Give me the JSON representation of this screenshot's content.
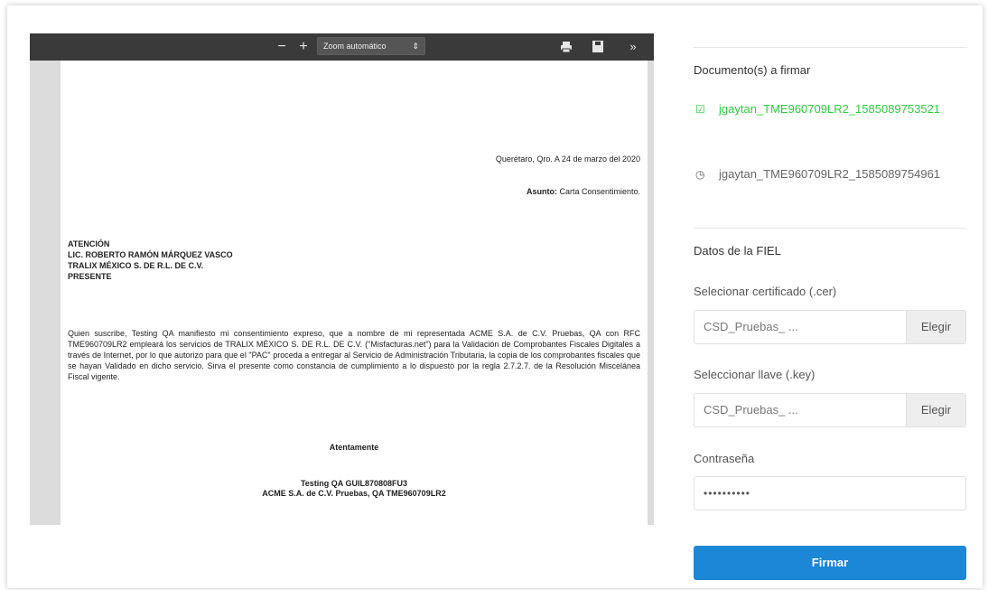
{
  "viewer": {
    "toolbar": {
      "zoom_out": "−",
      "zoom_in": "+",
      "zoom_label": "Zoom automático",
      "zoom_caret": "⇕",
      "print_icon": "print-icon",
      "save_icon": "save-icon",
      "more_icon": "double-chevron-right-icon"
    },
    "page": {
      "place_date": "Querétaro, Qro. A 24 de marzo del 2020",
      "subject_label": "Asunto:",
      "subject_value": " Carta Consentimiento.",
      "addressee": [
        "ATENCIÓN",
        "LIC. ROBERTO RAMÓN MÁRQUEZ VASCO",
        "TRALIX MÉXICO S. DE R.L. DE C.V.",
        "PRESENTE"
      ],
      "body": "Quien suscribe, Testing QA manifiesto mi consentimiento expreso, que a nombre de mi representada ACME S.A. de C.V. Pruebas, QA con RFC TME960709LR2 empleará los servicios de TRALIX MÉXICO S. DE R.L. DE C.V. (\"Misfacturas.net\") para la Validación de Comprobantes Fiscales Digitales a través de Internet, por lo que autorizo para que el \"PAC\" proceda a entregar al Servicio de Administración Tributaria, la copia de los comprobantes fiscales que se hayan Validado en dicho servicio. Sirva el presente como constancia de cumplimiento a lo dispuesto por la regla 2.7.2.7. de la Resolución Miscelánea Fiscal vigente.",
      "closing": "Atentamente",
      "signer_line1": "Testing QA GUIL870808FU3",
      "signer_line2": "ACME S.A. de C.V. Pruebas, QA TME960709LR2"
    }
  },
  "panel": {
    "documents_title": "Documento(s) a firmar",
    "documents": [
      {
        "name": "jgaytan_TME960709LR2_1585089753521",
        "status": "selected",
        "mark": "☑"
      },
      {
        "name": "jgaytan_TME960709LR2_1585089754961",
        "status": "pending",
        "mark": "◷"
      }
    ],
    "fiel_title": "Datos de la FIEL",
    "cert_label": "Selecionar certificado (.cer)",
    "cert_value": "CSD_Pruebas_ ...",
    "cert_button": "Elegir",
    "key_label": "Seleccionar llave (.key)",
    "key_value": "CSD_Pruebas_ ...",
    "key_button": "Elegir",
    "password_label": "Contraseña",
    "password_value": "••••••••••",
    "submit_label": "Firmar"
  },
  "colors": {
    "accent": "#1b87d6",
    "selected_doc": "#2ecc40",
    "viewer_toolbar": "#3a3a3a"
  }
}
